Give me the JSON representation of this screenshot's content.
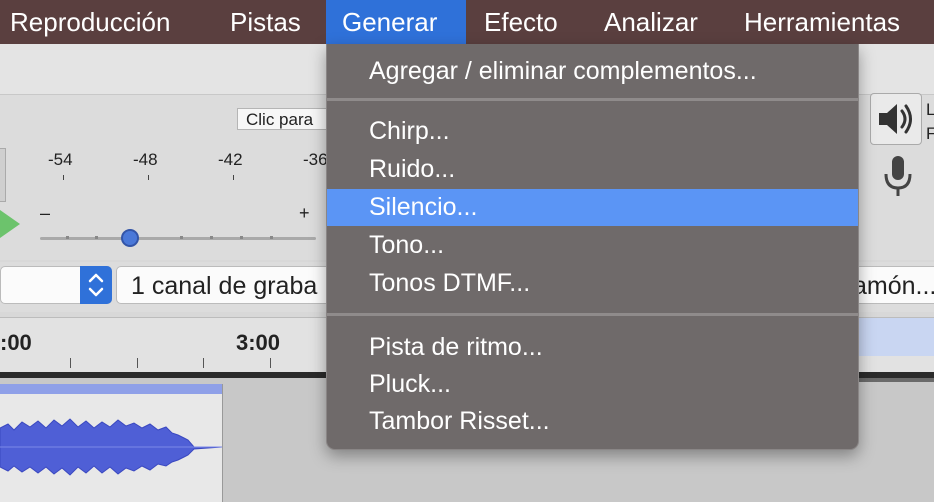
{
  "menubar": {
    "items": [
      {
        "label": "Reproducción"
      },
      {
        "label": "Pistas"
      },
      {
        "label": "Generar"
      },
      {
        "label": "Efecto"
      },
      {
        "label": "Analizar"
      },
      {
        "label": "Herramientas"
      }
    ],
    "active_index": 2
  },
  "toolbar": {
    "click_box_text": "Clic para",
    "right_letters": [
      "L",
      "F"
    ]
  },
  "meter": {
    "ticks": [
      "-54",
      "-48",
      "-42",
      "-36"
    ]
  },
  "slider": {
    "minus": "–",
    "plus": "+",
    "level": 0.33
  },
  "selectors": {
    "channel_text": "1 canal de graba",
    "right_text": "amón...",
    "stepper_glyph": "⌃\n⌄"
  },
  "timeline": {
    "labels": [
      ":00",
      "3:00"
    ]
  },
  "generate_menu": {
    "groups": [
      [
        "Agregar / eliminar complementos..."
      ],
      [
        "Chirp...",
        "Ruido...",
        "Silencio...",
        "Tono...",
        "Tonos DTMF..."
      ],
      [
        "Pista de ritmo...",
        "Pluck...",
        "Tambor Risset..."
      ]
    ],
    "highlighted": "Silencio..."
  },
  "colors": {
    "menubar_bg": "#5a3f3f",
    "active_menu": "#2f71d9",
    "menu_bg": "#6f6a6a",
    "highlight": "#5b95f5",
    "waveform": "#4f5fd6"
  },
  "icons": {
    "speaker": "speaker-icon",
    "mic": "microphone-icon",
    "play": "play-icon",
    "stepper": "updown-chevron-icon"
  }
}
